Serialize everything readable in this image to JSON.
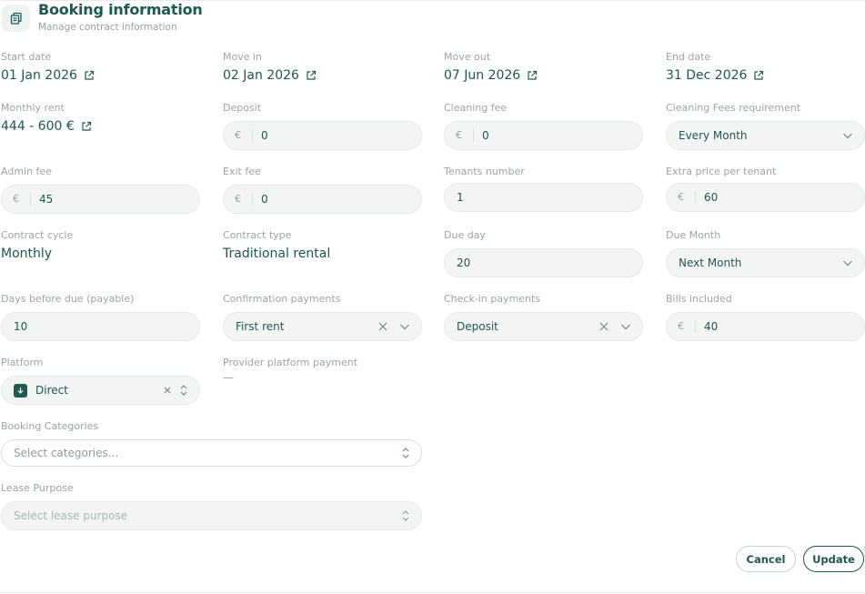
{
  "header": {
    "title": "Booking information",
    "subtitle": "Manage contract information",
    "icon": "document-copy-icon"
  },
  "fields": {
    "start_date": {
      "label": "Start date",
      "value": "01 Jan 2026"
    },
    "move_in": {
      "label": "Move in",
      "value": "02 Jan 2026"
    },
    "move_out": {
      "label": "Move out",
      "value": "07 Jun 2026"
    },
    "end_date": {
      "label": "End date",
      "value": "31 Dec 2026"
    },
    "monthly_rent": {
      "label": "Monthly rent",
      "value": "444 - 600 €"
    },
    "deposit": {
      "label": "Deposit",
      "currency": "€",
      "value": "0"
    },
    "cleaning_fee": {
      "label": "Cleaning fee",
      "currency": "€",
      "value": "0"
    },
    "cleaning_fees_requirement": {
      "label": "Cleaning Fees requirement",
      "value": "Every Month"
    },
    "admin_fee": {
      "label": "Admin fee",
      "currency": "€",
      "value": "45"
    },
    "exit_fee": {
      "label": "Exit fee",
      "currency": "€",
      "value": "0"
    },
    "tenants_number": {
      "label": "Tenants number",
      "value": "1"
    },
    "extra_price_per_tenant": {
      "label": "Extra price per tenant",
      "currency": "€",
      "value": "60"
    },
    "contract_cycle": {
      "label": "Contract cycle",
      "value": "Monthly"
    },
    "contract_type": {
      "label": "Contract type",
      "value": "Traditional rental"
    },
    "due_day": {
      "label": "Due day",
      "value": "20"
    },
    "due_month": {
      "label": "Due Month",
      "value": "Next Month"
    },
    "days_before_due": {
      "label": "Days before due (payable)",
      "value": "10"
    },
    "confirmation_payments": {
      "label": "Confirmation payments",
      "value": "First rent"
    },
    "checkin_payments": {
      "label": "Check-in payments",
      "value": "Deposit"
    },
    "bills_included": {
      "label": "Bills included",
      "currency": "€",
      "value": "40"
    },
    "platform": {
      "label": "Platform",
      "value": "Direct"
    },
    "provider_platform_payment": {
      "label": "Provider platform payment",
      "value": "—"
    },
    "booking_categories": {
      "label": "Booking Categories",
      "placeholder": "Select categories..."
    },
    "lease_purpose": {
      "label": "Lease Purpose",
      "placeholder": "Select lease purpose"
    }
  },
  "actions": {
    "cancel": "Cancel",
    "update": "Update"
  },
  "colors": {
    "primary": "#1e5b52",
    "input_bg": "#f2f5f4",
    "label": "#9aa5a3"
  }
}
